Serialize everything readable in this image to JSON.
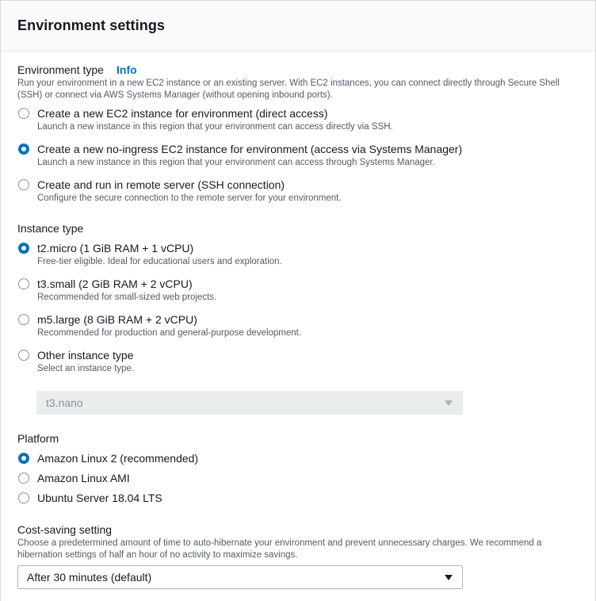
{
  "header": {
    "title": "Environment settings"
  },
  "environment_type": {
    "label": "Environment type",
    "info": "Info",
    "description": "Run your environment in a new EC2 instance or an existing server. With EC2 instances, you can connect directly through Secure Shell (SSH) or connect via AWS Systems Manager (without opening inbound ports).",
    "options": [
      {
        "label": "Create a new EC2 instance for environment (direct access)",
        "description": "Launch a new instance in this region that your environment can access directly via SSH.",
        "selected": false
      },
      {
        "label": "Create a new no-ingress EC2 instance for environment (access via Systems Manager)",
        "description": "Launch a new instance in this region that your environment can access through Systems Manager.",
        "selected": true
      },
      {
        "label": "Create and run in remote server (SSH connection)",
        "description": "Configure the secure connection to the remote server for your environment.",
        "selected": false
      }
    ]
  },
  "instance_type": {
    "label": "Instance type",
    "options": [
      {
        "label": "t2.micro (1 GiB RAM + 1 vCPU)",
        "description": "Free-tier eligible. Ideal for educational users and exploration.",
        "selected": true
      },
      {
        "label": "t3.small (2 GiB RAM + 2 vCPU)",
        "description": "Recommended for small-sized web projects.",
        "selected": false
      },
      {
        "label": "m5.large (8 GiB RAM + 2 vCPU)",
        "description": "Recommended for production and general-purpose development.",
        "selected": false
      },
      {
        "label": "Other instance type",
        "description": "Select an instance type.",
        "selected": false
      }
    ],
    "other_select": {
      "value": "t3.nano",
      "disabled": true
    }
  },
  "platform": {
    "label": "Platform",
    "options": [
      {
        "label": "Amazon Linux 2 (recommended)",
        "selected": true
      },
      {
        "label": "Amazon Linux AMI",
        "selected": false
      },
      {
        "label": "Ubuntu Server 18.04 LTS",
        "selected": false
      }
    ]
  },
  "cost_saving": {
    "label": "Cost-saving setting",
    "description": "Choose a predetermined amount of time to auto-hibernate your environment and prevent unnecessary charges. We recommend a hibernation settings of half an hour of no activity to maximize savings.",
    "select": {
      "value": "After 30 minutes (default)"
    }
  },
  "colors": {
    "accent": "#0073bb",
    "text": "#16191f",
    "secondary_text": "#545b64",
    "border": "#aab7b8",
    "disabled_bg": "#eaeded"
  },
  "icons": {
    "select_caret": "caret-down-icon"
  }
}
